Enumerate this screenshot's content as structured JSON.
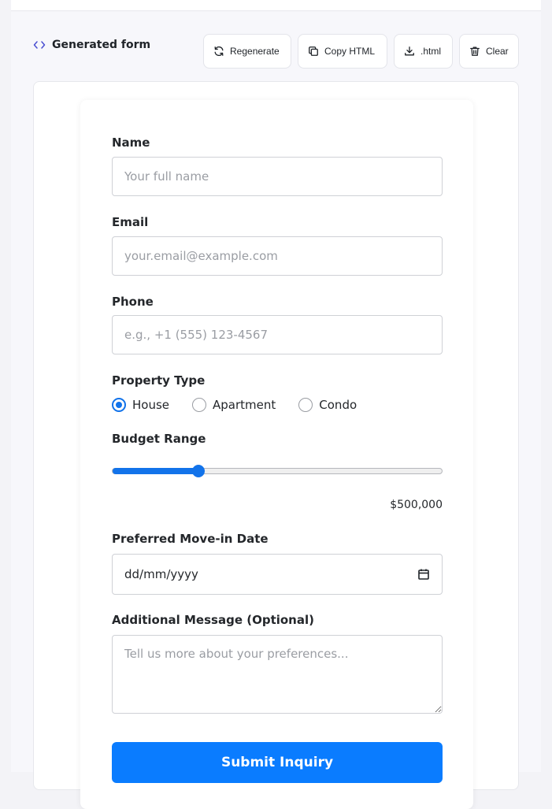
{
  "toolbar": {
    "title": "Generated form",
    "buttons": {
      "regenerate": "Regenerate",
      "copy_html": "Copy HTML",
      "download": ".html",
      "clear": "Clear"
    }
  },
  "form": {
    "name": {
      "label": "Name",
      "placeholder": "Your full name",
      "value": ""
    },
    "email": {
      "label": "Email",
      "placeholder": "your.email@example.com",
      "value": ""
    },
    "phone": {
      "label": "Phone",
      "placeholder": "e.g., +1 (555) 123-4567",
      "value": ""
    },
    "property_type": {
      "label": "Property Type",
      "options": [
        "House",
        "Apartment",
        "Condo"
      ],
      "selected": "House"
    },
    "budget": {
      "label": "Budget Range",
      "display_value": "$500,000",
      "fraction": 0.26
    },
    "move_in": {
      "label": "Preferred Move-in Date",
      "placeholder": "dd/mm/yyyy"
    },
    "message": {
      "label": "Additional Message (Optional)",
      "placeholder": "Tell us more about your preferences..."
    },
    "submit_label": "Submit Inquiry"
  },
  "colors": {
    "accent": "#0a7cff",
    "radio_accent": "#1273ea",
    "background": "#f7f7fb"
  }
}
